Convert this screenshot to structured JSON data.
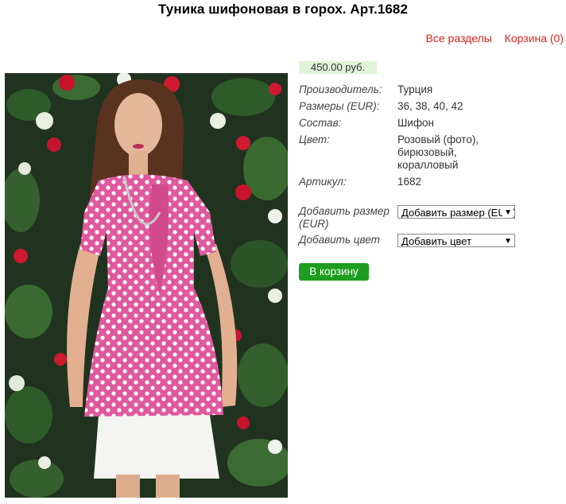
{
  "product": {
    "title": "Туника шифоновая в горох. Арт.1682",
    "price": "450.00 руб.",
    "properties": [
      {
        "label": "Производитель:",
        "value": "Турция"
      },
      {
        "label": "Размеры (EUR):",
        "value": "36, 38, 40, 42"
      },
      {
        "label": "Состав:",
        "value": "Шифон"
      },
      {
        "label": "Цвет:",
        "value": "Розовый (фото), бирюзовый, коралловый"
      },
      {
        "label": "Артикул:",
        "value": "1682"
      }
    ]
  },
  "nav": {
    "all_sections": "Все разделы",
    "cart": "Корзина (0)"
  },
  "options": {
    "size_label": "Добавить размер (EUR)",
    "size_value": "Добавить размер (EUR)",
    "color_label": "Добавить цвет",
    "color_value": "Добавить цвет"
  },
  "actions": {
    "add_to_cart": "В корзину"
  },
  "colors": {
    "link": "#d9261c",
    "price_bg": "#dff3d8",
    "button": "#1e9e1e",
    "dress": "#e0589e"
  }
}
